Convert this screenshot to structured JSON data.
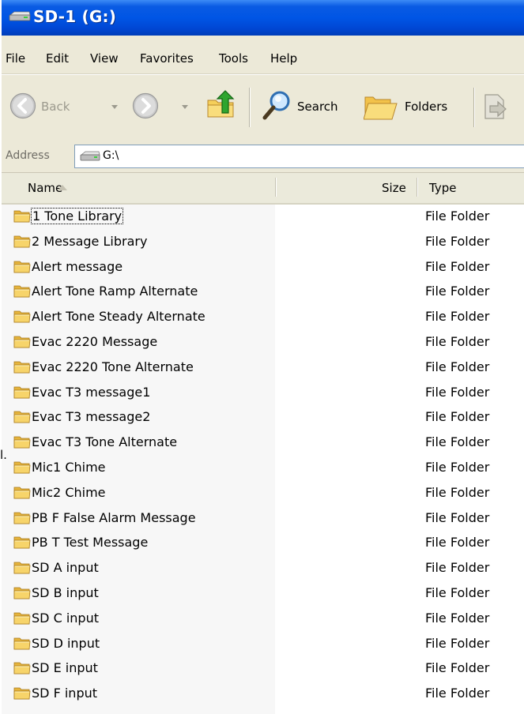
{
  "window": {
    "title": "SD-1 (G:)"
  },
  "menu": [
    "File",
    "Edit",
    "View",
    "Favorites",
    "Tools",
    "Help"
  ],
  "toolbar": {
    "back_label": "Back",
    "search_label": "Search",
    "folders_label": "Folders"
  },
  "address": {
    "label": "Address",
    "value": "G:\\"
  },
  "columns": {
    "name": "Name",
    "size": "Size",
    "type": "Type",
    "sorted_by": "Name",
    "sort_direction": "ascending"
  },
  "files": [
    {
      "name": "1 Tone Library",
      "size": "",
      "type": "File Folder"
    },
    {
      "name": "2 Message Library",
      "size": "",
      "type": "File Folder"
    },
    {
      "name": "Alert message",
      "size": "",
      "type": "File Folder"
    },
    {
      "name": "Alert Tone Ramp Alternate",
      "size": "",
      "type": "File Folder"
    },
    {
      "name": "Alert Tone Steady Alternate",
      "size": "",
      "type": "File Folder"
    },
    {
      "name": "Evac 2220 Message",
      "size": "",
      "type": "File Folder"
    },
    {
      "name": "Evac 2220 Tone Alternate",
      "size": "",
      "type": "File Folder"
    },
    {
      "name": "Evac T3 message1",
      "size": "",
      "type": "File Folder"
    },
    {
      "name": "Evac T3 message2",
      "size": "",
      "type": "File Folder"
    },
    {
      "name": "Evac T3 Tone Alternate",
      "size": "",
      "type": "File Folder"
    },
    {
      "name": "Mic1 Chime",
      "size": "",
      "type": "File Folder"
    },
    {
      "name": "Mic2 Chime",
      "size": "",
      "type": "File Folder"
    },
    {
      "name": "PB F False Alarm Message",
      "size": "",
      "type": "File Folder"
    },
    {
      "name": "PB T Test Message",
      "size": "",
      "type": "File Folder"
    },
    {
      "name": "SD A input",
      "size": "",
      "type": "File Folder"
    },
    {
      "name": "SD B input",
      "size": "",
      "type": "File Folder"
    },
    {
      "name": "SD C input",
      "size": "",
      "type": "File Folder"
    },
    {
      "name": "SD D input",
      "size": "",
      "type": "File Folder"
    },
    {
      "name": "SD E input",
      "size": "",
      "type": "File Folder"
    },
    {
      "name": "SD F input",
      "size": "",
      "type": "File Folder"
    }
  ],
  "stray_text": "l.",
  "colors": {
    "titlebar": "#0055e5",
    "chrome": "#ece9d8",
    "folder": "#f5cf5a"
  },
  "icons": {
    "drive": "drive-icon",
    "folder": "folder-icon",
    "back": "back-arrow-icon",
    "forward": "forward-arrow-icon",
    "up": "up-folder-icon",
    "search": "search-icon",
    "folders": "folders-icon",
    "move_to": "move-to-icon"
  }
}
